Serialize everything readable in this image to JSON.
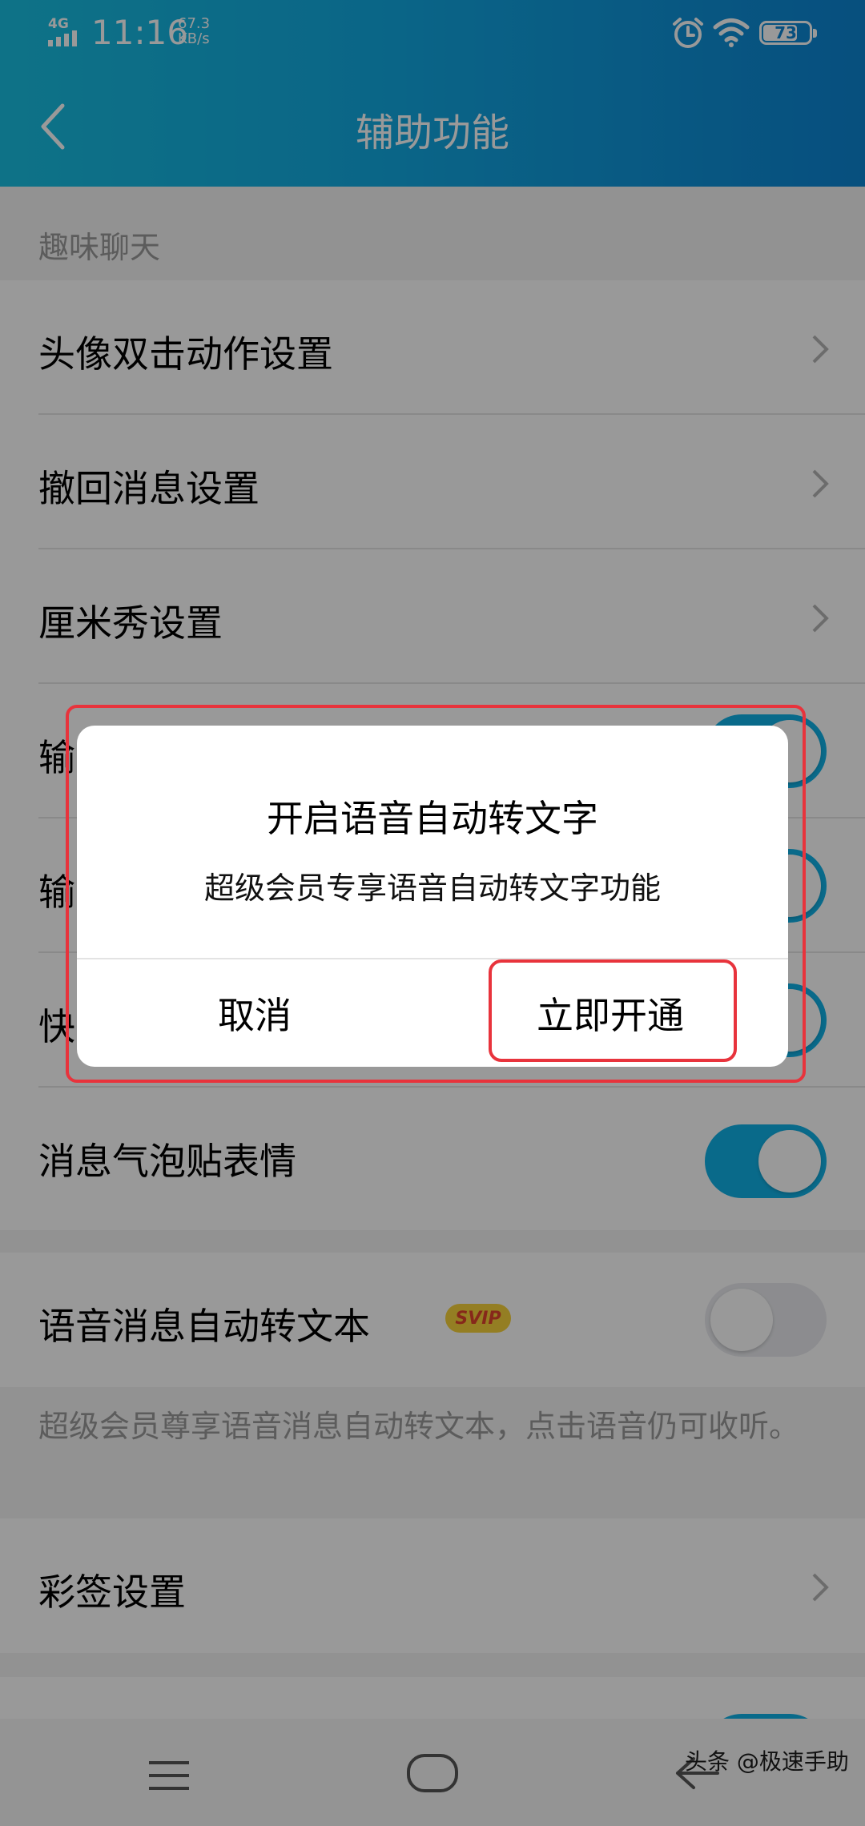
{
  "status_bar": {
    "network": "4G",
    "time": "11:16",
    "speed_value": "67.3",
    "speed_unit": "KB/s",
    "battery": "73"
  },
  "header": {
    "title": "辅助功能",
    "back_icon": "chevron-left-icon"
  },
  "section": {
    "label": "趣味聊天"
  },
  "rows": {
    "avatar_double_tap": "头像双击动作设置",
    "recall_message": "撤回消息设置",
    "cmshow": "厘米秀设置",
    "input_1_partial": "输",
    "input_2_partial": "输",
    "quick_partial": "快",
    "bubble_sticker": "消息气泡贴表情",
    "voice_to_text": "语音消息自动转文本",
    "voice_to_text_badge": "SVIP",
    "voice_to_text_note": "超级会员尊享语音消息自动转文本，点击语音仍可收听。",
    "color_tag": "彩签设置"
  },
  "toggles": {
    "input_1": "on",
    "input_2": "on",
    "quick": "on",
    "bubble_sticker": "on",
    "voice_to_text": "off",
    "bottom_cutoff": "on"
  },
  "dialog": {
    "title": "开启语音自动转文字",
    "message": "超级会员专享语音自动转文字功能",
    "cancel_label": "取消",
    "confirm_label": "立即开通"
  },
  "nav": {
    "menu_icon": "menu-icon",
    "home_icon": "home-icon",
    "back_icon": "back-arrow-icon"
  },
  "watermark": "头条 @极速手助",
  "colors": {
    "header_start": "#18bfe2",
    "header_end": "#0c84d3",
    "toggle_on": "#10b1e6",
    "highlight_red": "#e8333c",
    "svip_bg": "#f7d23b"
  }
}
